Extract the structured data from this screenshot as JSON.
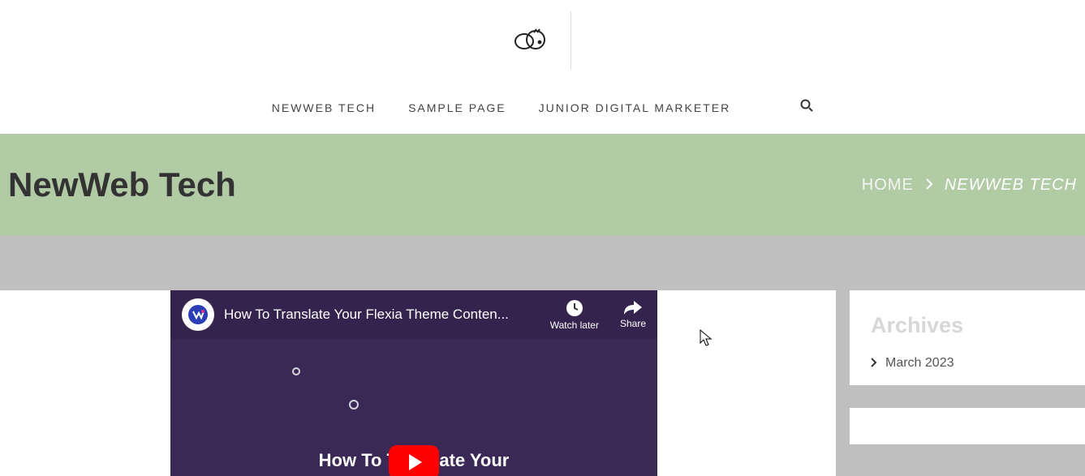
{
  "nav": {
    "items": [
      "NEWWEB TECH",
      "SAMPLE PAGE",
      "JUNIOR DIGITAL MARKETER"
    ]
  },
  "pageTitle": "NewWeb Tech",
  "breadcrumb": {
    "home": "HOME",
    "current": "NEWWEB TECH"
  },
  "video": {
    "title": "How To Translate Your Flexia Theme Conten...",
    "watchLater": "Watch later",
    "share": "Share",
    "caption": "How To Translate Your"
  },
  "sidebar": {
    "archives": {
      "title": "Archives",
      "items": [
        "March 2023"
      ]
    }
  }
}
